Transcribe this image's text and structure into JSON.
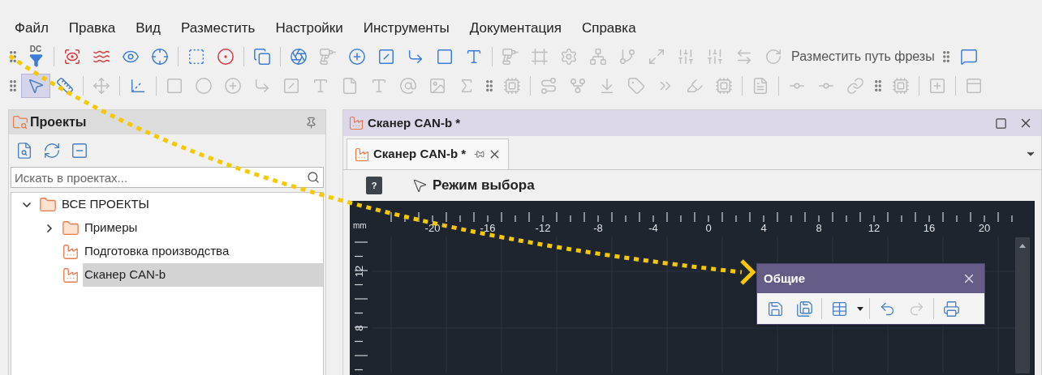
{
  "menu": [
    "Файл",
    "Правка",
    "Вид",
    "Разместить",
    "Настройки",
    "Инструменты",
    "Документация",
    "Справка"
  ],
  "toolbar_rows": [
    {
      "items": [
        {
          "kind": "grip"
        },
        {
          "kind": "dc-filter",
          "label": "DC",
          "disabled": false,
          "color": "#3b7dd8"
        },
        {
          "kind": "separator"
        },
        {
          "kind": "scan-eye",
          "disabled": false,
          "color": "#d9363e"
        },
        {
          "kind": "waves",
          "disabled": false,
          "color": "#d9363e"
        },
        {
          "kind": "eye",
          "disabled": false,
          "color": "#3b7dd8"
        },
        {
          "kind": "crosshair",
          "disabled": false,
          "color": "#3b7dd8"
        },
        {
          "kind": "separator"
        },
        {
          "kind": "square-dashed",
          "disabled": false,
          "color": "#3b7dd8"
        },
        {
          "kind": "circle-dot",
          "disabled": false,
          "color": "#d9363e"
        },
        {
          "kind": "separator"
        },
        {
          "kind": "copy",
          "disabled": false,
          "color": "#3b7dd8"
        },
        {
          "kind": "separator"
        },
        {
          "kind": "aperture",
          "disabled": false,
          "color": "#3b7dd8"
        },
        {
          "kind": "drill",
          "disabled": true
        },
        {
          "kind": "circle-plus",
          "disabled": false,
          "color": "#3b7dd8"
        },
        {
          "kind": "square-slash",
          "disabled": false,
          "color": "#3b7dd8"
        },
        {
          "kind": "corner",
          "disabled": false,
          "color": "#3b7dd8"
        },
        {
          "kind": "square",
          "disabled": false,
          "color": "#3b7dd8"
        },
        {
          "kind": "type",
          "disabled": false,
          "color": "#3b7dd8"
        },
        {
          "kind": "separator"
        },
        {
          "kind": "drill",
          "disabled": true
        },
        {
          "kind": "frame",
          "disabled": true
        },
        {
          "kind": "settings",
          "disabled": true
        },
        {
          "kind": "network",
          "disabled": true
        },
        {
          "kind": "branch",
          "disabled": true
        },
        {
          "kind": "maximize",
          "disabled": true
        },
        {
          "kind": "sliders",
          "disabled": true
        },
        {
          "kind": "sliders",
          "disabled": true
        },
        {
          "kind": "arrows",
          "disabled": true
        },
        {
          "kind": "rotate",
          "disabled": true
        },
        {
          "kind": "text",
          "label": "Разместить путь фрезы",
          "disabled": false
        },
        {
          "kind": "grip"
        },
        {
          "kind": "message",
          "disabled": false,
          "color": "#3b7dd8"
        }
      ]
    },
    {
      "items": [
        {
          "kind": "grip"
        },
        {
          "kind": "pointer",
          "disabled": false,
          "selected": true
        },
        {
          "kind": "ruler",
          "disabled": false,
          "selected": false
        },
        {
          "kind": "separator"
        },
        {
          "kind": "move",
          "disabled": true,
          "selected": false
        },
        {
          "kind": "separator"
        },
        {
          "kind": "axes",
          "disabled": false,
          "selected": false
        },
        {
          "kind": "separator"
        },
        {
          "kind": "square",
          "disabled": true,
          "selected": false
        },
        {
          "kind": "circle",
          "disabled": true,
          "selected": false
        },
        {
          "kind": "circle-plus",
          "disabled": true,
          "selected": false
        },
        {
          "kind": "corner",
          "disabled": true,
          "selected": false
        },
        {
          "kind": "square-slash",
          "disabled": true,
          "selected": false
        },
        {
          "kind": "type",
          "disabled": true,
          "selected": false
        },
        {
          "kind": "file",
          "disabled": true,
          "selected": false
        },
        {
          "kind": "type",
          "disabled": true,
          "selected": false
        },
        {
          "kind": "at-sign",
          "disabled": true,
          "selected": false
        },
        {
          "kind": "image",
          "disabled": true,
          "selected": false
        },
        {
          "kind": "sigma",
          "disabled": true,
          "selected": false
        },
        {
          "kind": "grip"
        },
        {
          "kind": "chip",
          "disabled": true,
          "selected": false
        },
        {
          "kind": "separator"
        },
        {
          "kind": "route",
          "disabled": true,
          "selected": false
        },
        {
          "kind": "fork",
          "disabled": true,
          "selected": false
        },
        {
          "kind": "ground",
          "disabled": true,
          "selected": false
        },
        {
          "kind": "tag",
          "disabled": true,
          "selected": false
        },
        {
          "kind": "chevrons",
          "disabled": true,
          "selected": false
        },
        {
          "kind": "highlighter",
          "disabled": true,
          "selected": false
        },
        {
          "kind": "chip",
          "disabled": true,
          "selected": false
        },
        {
          "kind": "separator"
        },
        {
          "kind": "file-text",
          "disabled": true,
          "selected": false
        },
        {
          "kind": "separator"
        },
        {
          "kind": "commit",
          "disabled": true,
          "selected": false
        },
        {
          "kind": "commit",
          "disabled": true,
          "selected": false
        },
        {
          "kind": "link",
          "disabled": true,
          "selected": false
        },
        {
          "kind": "grip"
        },
        {
          "kind": "chip",
          "disabled": true,
          "selected": false
        },
        {
          "kind": "separator"
        },
        {
          "kind": "square-plus",
          "disabled": true,
          "selected": false
        },
        {
          "kind": "separator"
        },
        {
          "kind": "panel",
          "disabled": true,
          "selected": false
        }
      ]
    }
  ],
  "projects_panel": {
    "title": "Проекты",
    "search": {
      "placeholder": "Искать в проектах..."
    },
    "tree": [
      {
        "label": "ВСЕ ПРОЕКТЫ",
        "kind": "folder",
        "expanded": true,
        "selected": false,
        "children": [
          {
            "label": "Примеры",
            "kind": "folder",
            "expanded": false,
            "selected": false
          },
          {
            "label": "Подготовка производства",
            "kind": "project",
            "selected": false
          },
          {
            "label": "Сканер CAN-b",
            "kind": "project",
            "selected": true
          }
        ]
      }
    ]
  },
  "document": {
    "title": "Сканер CAN-b *",
    "tabs": [
      {
        "label": "Сканер CAN-b *",
        "selected": true
      }
    ],
    "help": "?",
    "mode": "Режим выбора",
    "ruler": {
      "unit": "mm",
      "x_labels": [
        "-20",
        "-16",
        "-12",
        "-8",
        "-4",
        "0",
        "4",
        "8",
        "12",
        "16",
        "20"
      ],
      "y_labels": [
        "12",
        "8"
      ]
    },
    "floating_toolbar": {
      "title": "Общие",
      "items": [
        {
          "kind": "save",
          "disabled": false
        },
        {
          "kind": "save-all",
          "disabled": false
        },
        {
          "kind": "separator"
        },
        {
          "kind": "table",
          "disabled": false
        },
        {
          "kind": "caret",
          "disabled": false
        },
        {
          "kind": "separator"
        },
        {
          "kind": "undo",
          "disabled": false
        },
        {
          "kind": "redo",
          "disabled": true
        },
        {
          "kind": "separator"
        },
        {
          "kind": "print",
          "disabled": false
        }
      ]
    }
  }
}
